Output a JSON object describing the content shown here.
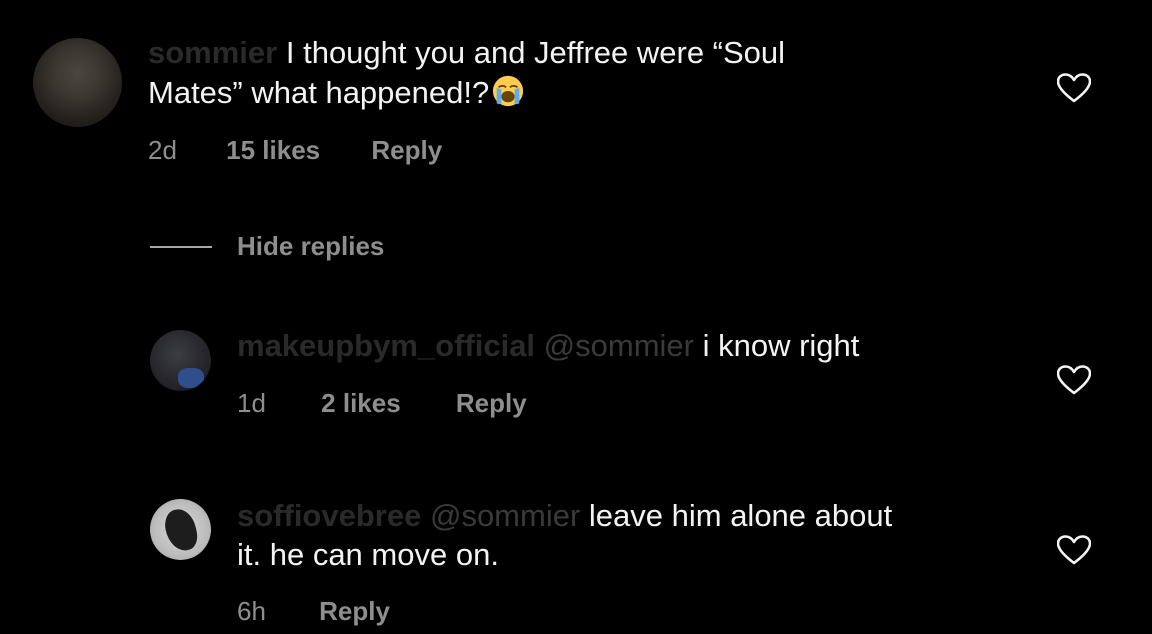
{
  "comments": [
    {
      "username": "sommier",
      "line1": "I thought you and Jeffree were “Soul",
      "line2": "Mates” what happened!?",
      "emoji": "loudly-crying-face-emoji",
      "time": "2d",
      "likes": "15 likes",
      "reply_label": "Reply"
    }
  ],
  "hide_replies_label": "Hide replies",
  "replies": [
    {
      "username": "makeupbym_official",
      "mention": "@sommier",
      "text": "i know right",
      "time": "1d",
      "likes": "2 likes",
      "reply_label": "Reply"
    },
    {
      "username": "soffiovebree",
      "mention": "@sommier",
      "line1": "leave him alone about",
      "line2": "it. he can move on.",
      "time": "6h",
      "reply_label": "Reply"
    }
  ],
  "icons": {
    "like": "heart-outline-icon"
  },
  "colors": {
    "background": "#000000",
    "text": "#f3f3f3",
    "meta": "#8e8e8e"
  }
}
